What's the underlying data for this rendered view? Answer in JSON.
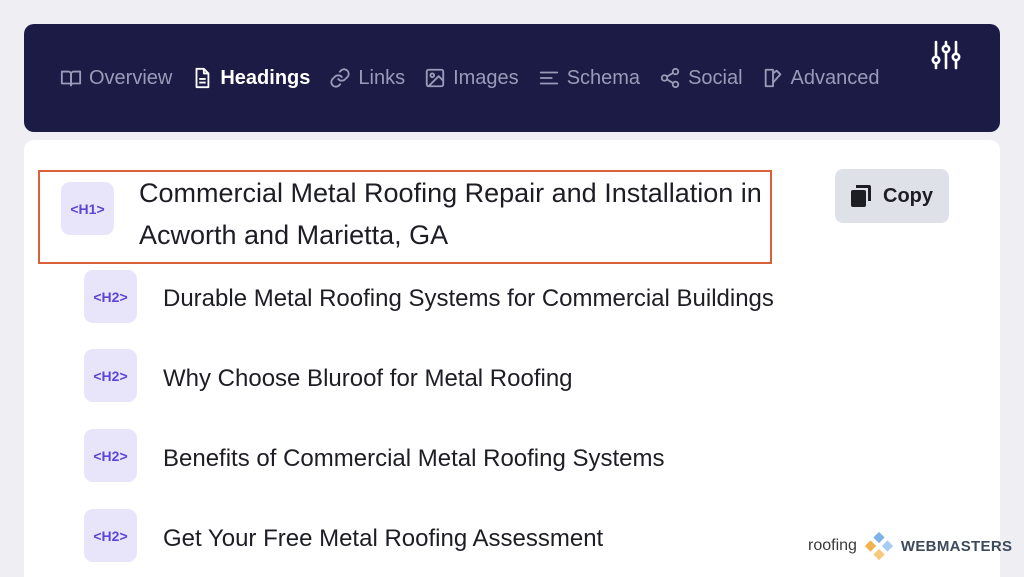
{
  "nav": {
    "items": [
      {
        "label": "Overview",
        "icon": "book-icon"
      },
      {
        "label": "Headings",
        "icon": "document-icon",
        "active": true
      },
      {
        "label": "Links",
        "icon": "link-icon"
      },
      {
        "label": "Images",
        "icon": "image-icon"
      },
      {
        "label": "Schema",
        "icon": "list-icon"
      },
      {
        "label": "Social",
        "icon": "share-icon"
      },
      {
        "label": "Advanced",
        "icon": "cube-icon"
      }
    ],
    "settings_icon": "sliders-icon"
  },
  "colors": {
    "nav_bg": "#1b1b46",
    "highlight_border": "#d9603b",
    "tag_bg": "#e8e5fb",
    "tag_text": "#5b46d6"
  },
  "headings": {
    "h1": {
      "tag": "<H1>",
      "text": "Commercial Metal Roofing Repair and Installation in Acworth and Marietta, GA"
    },
    "h2": [
      {
        "tag": "<H2>",
        "text": "Durable Metal Roofing Systems for Commercial Buildings"
      },
      {
        "tag": "<H2>",
        "text": "Why Choose Bluroof for Metal Roofing"
      },
      {
        "tag": "<H2>",
        "text": "Benefits of Commercial Metal Roofing Systems"
      },
      {
        "tag": "<H2>",
        "text": "Get Your Free Metal Roofing Assessment"
      }
    ]
  },
  "copy_button": {
    "label": "Copy",
    "icon": "clipboard-icon"
  },
  "watermark": {
    "word1": "roofing",
    "word2": "WEBMASTERS"
  }
}
